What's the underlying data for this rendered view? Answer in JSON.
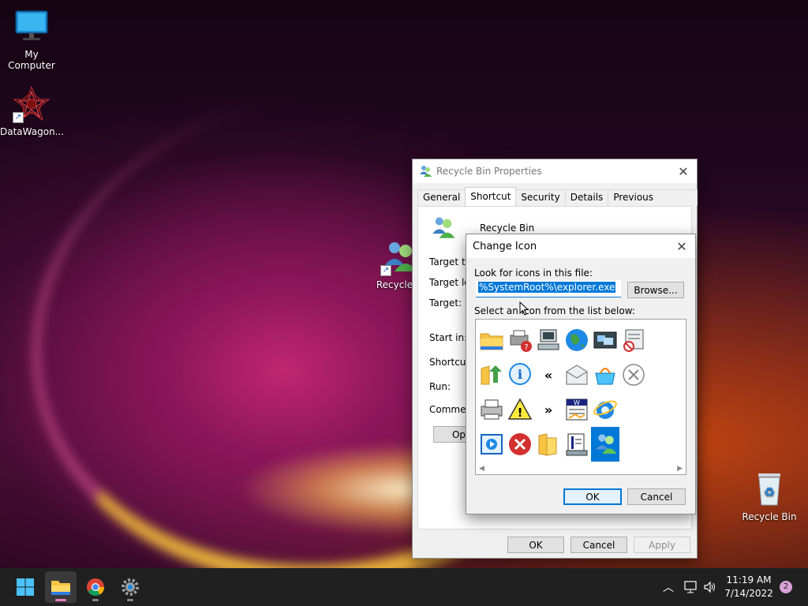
{
  "desktop": {
    "icons": [
      {
        "label": "My Computer",
        "icon": "monitor-icon"
      },
      {
        "label": "DataWagon...",
        "icon": "datawagon-logo-icon"
      },
      {
        "label": "Recycle B",
        "icon": "users-icon"
      },
      {
        "label": "Recycle Bin",
        "icon": "recycle-bin-icon"
      }
    ]
  },
  "properties": {
    "title": "Recycle Bin Properties",
    "tabs": [
      "General",
      "Shortcut",
      "Security",
      "Details",
      "Previous Versions"
    ],
    "active_tab": "Shortcut",
    "name": "Recycle Bin",
    "labels": {
      "target_type": "Target typ",
      "target_location": "Target loc",
      "target": "Target:",
      "start_in": "Start in:",
      "shortcut_key": "Shortcut k",
      "run": "Run:",
      "comment": "Comment:"
    },
    "open_button": "Open",
    "ok": "OK",
    "cancel": "Cancel",
    "apply": "Apply"
  },
  "change_icon": {
    "title": "Change Icon",
    "file_label": "Look for icons in this file:",
    "file_value": "%SystemRoot%\\explorer.exe",
    "browse": "Browse...",
    "list_label": "Select an icon from the list below:",
    "icons": [
      "folder-icon",
      "printer-help-icon",
      "computer-icon",
      "globe-icon",
      "network-windows-icon",
      "blocked-document-icon",
      "folder-up-icon",
      "info-icon",
      "double-chevron-left-icon",
      "mail-icon",
      "shopping-basket-icon",
      "close-circle-icon",
      "printer-icon",
      "warning-icon",
      "double-chevron-right-icon",
      "word-document-icon",
      "internet-explorer-icon",
      "media-player-icon",
      "error-icon",
      "folder-open-icon",
      "server-document-icon",
      "users-icon"
    ],
    "selected_index": 21,
    "ok": "OK",
    "cancel": "Cancel"
  },
  "taskbar": {
    "apps": [
      "windows-start-icon",
      "file-explorer-icon",
      "chrome-icon",
      "settings-gear-icon"
    ],
    "time": "11:19 AM",
    "date": "7/14/2022",
    "notification_count": "2"
  }
}
